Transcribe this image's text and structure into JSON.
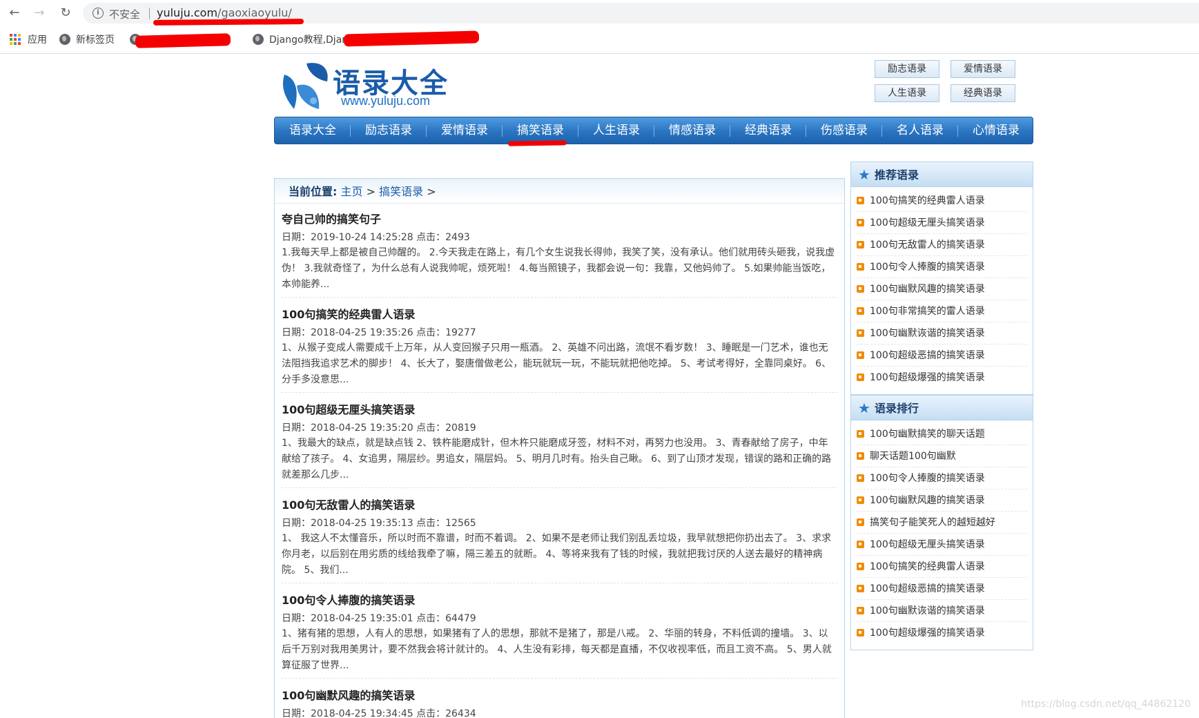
{
  "browser": {
    "insecure_label": "不安全",
    "url_domain": "yuluju.com",
    "url_path": "/gaoxiaoyulu/",
    "bookmarks": [
      "应用",
      "新标签页",
      "Django教程,Django"
    ]
  },
  "site": {
    "logo_title": "语录大全",
    "logo_url": "www.yuluju.com",
    "top_links": [
      "励志语录",
      "爱情语录",
      "人生语录",
      "经典语录"
    ],
    "nav": [
      "语录大全",
      "励志语录",
      "爱情语录",
      "搞笑语录",
      "人生语录",
      "情感语录",
      "经典语录",
      "伤感语录",
      "名人语录",
      "心情语录"
    ]
  },
  "breadcrumb": {
    "label": "当前位置:",
    "home": "主页",
    "sep": ">",
    "current": "搞笑语录",
    "trail": ">"
  },
  "articles": [
    {
      "title": "夸自己帅的搞笑句子",
      "meta": "日期：2019-10-24 14:25:28 点击：2493",
      "summary": "1.我每天早上都是被自己帅醒的。 2.今天我走在路上，有几个女生说我长得帅，我笑了笑，没有承认。他们就用砖头砸我，说我虚伪！ 3.我就奇怪了，为什么总有人说我帅呢，烦死啦！ 4.每当照镜子，我都会说一句：我靠，又他妈帅了。 5.如果帅能当饭吃，本帅能养..."
    },
    {
      "title": "100句搞笑的经典雷人语录",
      "meta": "日期：2018-04-25 19:35:26 点击：19277",
      "summary": "1、从猴子变成人需要成千上万年，从人变回猴子只用一瓶酒。 2、英雄不问出路，流氓不看岁数！ 3、睡眠是一门艺术，谁也无法阻挡我追求艺术的脚步！ 4、长大了，娶唐僧做老公，能玩就玩一玩，不能玩就把他吃掉。 5、考试考得好，全靠同桌好。 6、分手多没意思..."
    },
    {
      "title": "100句超级无厘头搞笑语录",
      "meta": "日期：2018-04-25 19:35:20 点击：20819",
      "summary": "1、我最大的缺点，就是缺点钱 2、铁杵能磨成针，但木杵只能磨成牙签，材料不对，再努力也没用。 3、青春献给了房子，中年献给了孩子。 4、女追男，隔层纱。男追女，隔层妈。 5、明月几时有。抬头自己瞅。 6、到了山顶才发现，错误的路和正确的路就差那么几步..."
    },
    {
      "title": "100句无敌雷人的搞笑语录",
      "meta": "日期：2018-04-25 19:35:13 点击：12565",
      "summary": "1、 我这人不太懂音乐，所以时而不靠谱，时而不着调。 2、如果不是老师让我们别乱丢垃圾，我早就想把你扔出去了。 3、求求你月老，以后别在用劣质的线给我牵了嘛，隔三差五的就断。 4、等将来我有了钱的时候，我就把我讨厌的人送去最好的精神病院。 5、我们..."
    },
    {
      "title": "100句令人捧腹的搞笑语录",
      "meta": "日期：2018-04-25 19:35:01 点击：64479",
      "summary": "1、猪有猪的思想，人有人的思想，如果猪有了人的思想，那就不是猪了，那是八戒。 2、华丽的转身，不料低调的撞墙。 3、以后千万别对我用美男计，要不然我会将计就计的。 4、人生没有彩排，每天都是直播，不仅收视率低，而且工资不高。 5、男人就算征服了世界..."
    },
    {
      "title": "100句幽默风趣的搞笑语录",
      "meta": "日期：2018-04-25 19:34:45 点击：26434",
      "summary": ""
    }
  ],
  "sidebar": {
    "recommend_title": "推荐语录",
    "recommend": [
      "100句搞笑的经典雷人语录",
      "100句超级无厘头搞笑语录",
      "100句无敌雷人的搞笑语录",
      "100句令人捧腹的搞笑语录",
      "100句幽默风趣的搞笑语录",
      "100句非常搞笑的雷人语录",
      "100句幽默诙谐的搞笑语录",
      "100句超级恶搞的搞笑语录",
      "100句超级爆强的搞笑语录"
    ],
    "ranking_title": "语录排行",
    "ranking": [
      "100句幽默搞笑的聊天话题",
      "聊天话题100句幽默",
      "100句令人捧腹的搞笑语录",
      "100句幽默风趣的搞笑语录",
      "搞笑句子能笑死人的越短越好",
      "100句超级无厘头搞笑语录",
      "100句搞笑的经典雷人语录",
      "100句超级恶搞的搞笑语录",
      "100句幽默诙谐的搞笑语录",
      "100句超级爆强的搞笑语录"
    ]
  },
  "watermark": "https://blog.csdn.net/qq_44862120",
  "colors": {
    "nav_blue": "#2a74c1",
    "accent_red": "#f40000",
    "bullet_orange": "#f08c00"
  }
}
